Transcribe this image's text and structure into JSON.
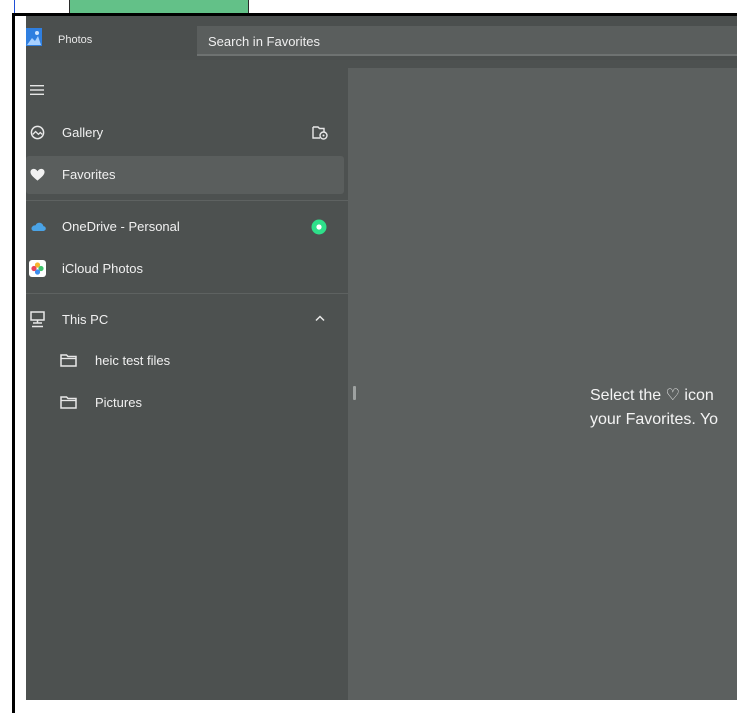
{
  "app": {
    "title": "Photos"
  },
  "search": {
    "value": "Search in Favorites"
  },
  "sidebar": {
    "items": [
      {
        "label": "Gallery"
      },
      {
        "label": "Favorites"
      },
      {
        "label": "OneDrive - Personal"
      },
      {
        "label": "iCloud Photos"
      },
      {
        "label": "This PC"
      },
      {
        "label": "heic test files"
      },
      {
        "label": "Pictures"
      }
    ]
  },
  "content": {
    "message_line1": "Select the ♡ icon",
    "message_line2": "your Favorites. Yo"
  },
  "colors": {
    "status_green": "#2ee08a",
    "onedrive_blue": "#4aa3e6"
  }
}
